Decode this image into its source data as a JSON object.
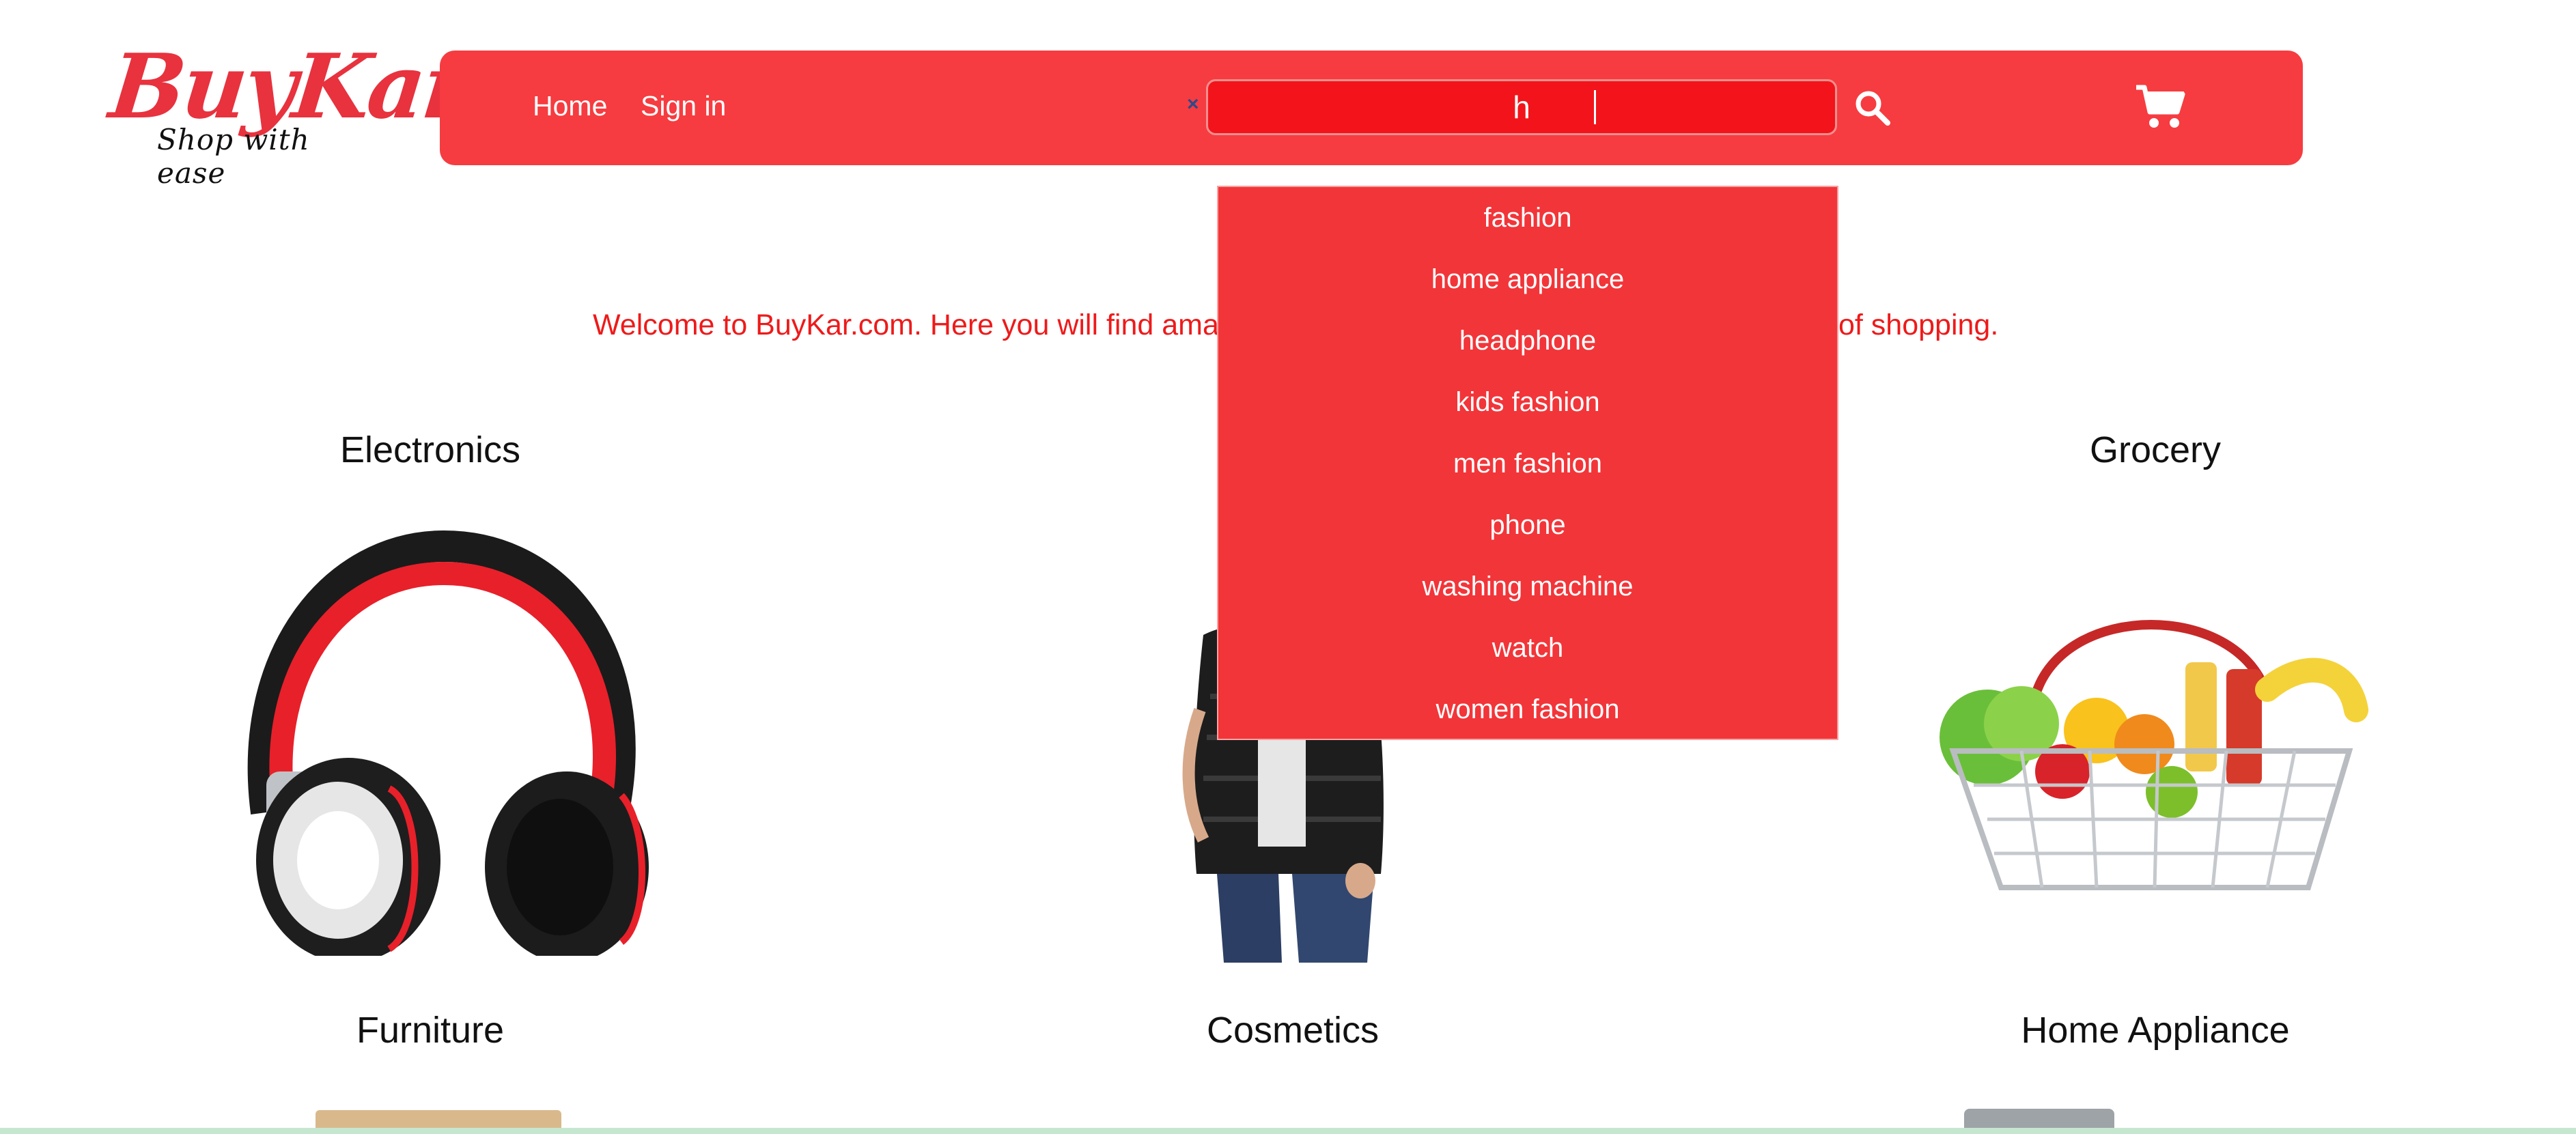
{
  "logo": {
    "brand": "BuyKar",
    "tagline": "Shop with ease"
  },
  "nav": {
    "home": "Home",
    "signin": "Sign in",
    "search_value": "h",
    "search_clear": "×",
    "icons": {
      "search": "search-icon",
      "cart": "cart-icon"
    }
  },
  "suggestions": [
    "fashion",
    "home appliance",
    "headphone",
    "kids fashion",
    "men fashion",
    "phone",
    "washing machine",
    "watch",
    "women fashion"
  ],
  "welcome": {
    "left": "Welcome to BuyKar.com. Here you will find amaz",
    "right": "of shopping."
  },
  "categories": [
    "Electronics",
    "Grocery",
    "Furniture",
    "Cosmetics",
    "Home Appliance"
  ],
  "colors": {
    "brand_red": "#f63c40",
    "search_red": "#f2141a",
    "dropdown_red": "#f23539",
    "welcome_red": "#ee1a1a"
  }
}
